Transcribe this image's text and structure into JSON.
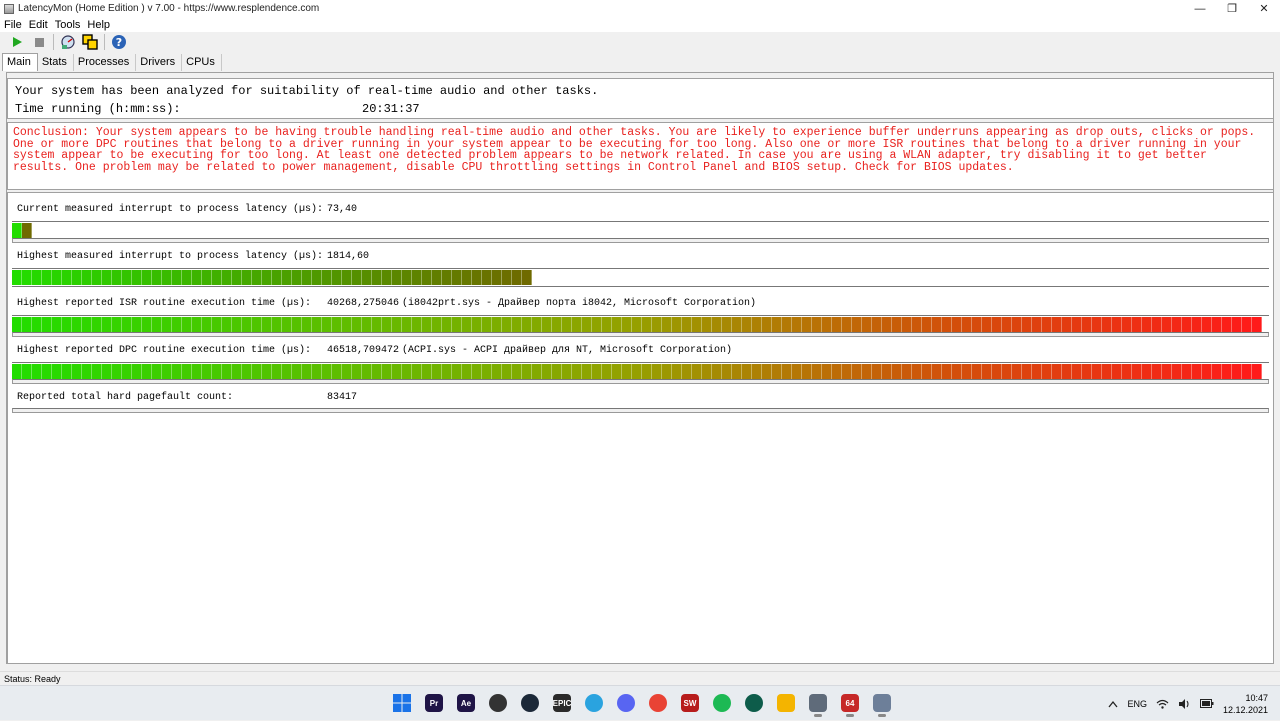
{
  "window": {
    "title": "LatencyMon  (Home Edition )  v 7.00 - https://www.resplendence.com",
    "minimize": "—",
    "maximize": "❐",
    "close": "✕"
  },
  "menu": [
    {
      "label": "File"
    },
    {
      "label": "Edit"
    },
    {
      "label": "Tools"
    },
    {
      "label": "Help"
    }
  ],
  "tabs": [
    {
      "label": "Main"
    },
    {
      "label": "Stats"
    },
    {
      "label": "Processes"
    },
    {
      "label": "Drivers"
    },
    {
      "label": "CPUs"
    }
  ],
  "summary": {
    "analyzed": "Your system has been analyzed for suitability of real-time audio and other tasks.",
    "time_label": "Time running (h:mm:ss):",
    "time_value": "20:31:37"
  },
  "conclusion": "Conclusion: Your system appears to be having trouble handling real-time audio and other tasks. You are likely to experience buffer underruns appearing as drop outs, clicks or pops. One or more DPC routines that belong to a driver running in your system appear to be executing for too long. Also one or more ISR routines that belong to a driver running in your system appear to be executing for too long. At least one detected problem appears to be network related. In case you are using a WLAN adapter, try disabling it to get better results. One problem may be related to power management, disable CPU throttling settings in Control Panel and BIOS setup. Check for BIOS updates.",
  "metrics": {
    "current": {
      "label": "Current measured interrupt to process latency (µs):",
      "value": "73,40",
      "fill": 0.017
    },
    "highest": {
      "label": "Highest measured interrupt to process latency (µs):",
      "value": "1814,60",
      "fill": 0.415
    },
    "isr": {
      "label": "Highest reported ISR routine execution time (µs):",
      "value": "40268,275046",
      "extra": "(i8042prt.sys - Драйвер порта i8042, Microsoft Corporation)",
      "fill": 1.0
    },
    "dpc": {
      "label": "Highest reported DPC routine execution time (µs):",
      "value": "46518,709472",
      "extra": "(ACPI.sys - ACPI драйвер для NT, Microsoft Corporation)",
      "fill": 1.0
    },
    "pagefault": {
      "label": "Reported total hard pagefault count:",
      "value": "83417"
    }
  },
  "status": "Status: Ready",
  "taskbar": {
    "apps": [
      {
        "icon": "windows-start-icon",
        "text": "",
        "color": "#1a73e8"
      },
      {
        "icon": "premiere-icon",
        "text": "Pr",
        "color": "#1f1446"
      },
      {
        "icon": "after-effects-icon",
        "text": "Ae",
        "color": "#1f1446"
      },
      {
        "icon": "obs-icon",
        "text": "",
        "color": "#333"
      },
      {
        "icon": "steam-icon",
        "text": "",
        "color": "#1b2838"
      },
      {
        "icon": "epic-games-icon",
        "text": "EPIC",
        "color": "#2a2a2a"
      },
      {
        "icon": "telegram-icon",
        "text": "",
        "color": "#2aa3df"
      },
      {
        "icon": "discord-icon",
        "text": "",
        "color": "#5865f2"
      },
      {
        "icon": "chrome-icon",
        "text": "",
        "color": "#e94335"
      },
      {
        "icon": "shadow-warrior-icon",
        "text": "SW",
        "color": "#b71c1c"
      },
      {
        "icon": "spotify-icon",
        "text": "",
        "color": "#1db954"
      },
      {
        "icon": "vpn-icon",
        "text": "",
        "color": "#0d5c4a"
      },
      {
        "icon": "file-explorer-icon",
        "text": "",
        "color": "#f4b400"
      },
      {
        "icon": "settings-icon",
        "text": "",
        "color": "#5f6b7a"
      },
      {
        "icon": "aida64-icon",
        "text": "64",
        "color": "#c62828"
      },
      {
        "icon": "latencymon-icon",
        "text": "",
        "color": "#6d7f99"
      }
    ],
    "lang": "ENG",
    "time": "10:47",
    "date": "12.12.2021"
  },
  "colors": {
    "conclusion_text": "#e8211e",
    "bar_green": "#22dd00",
    "bar_olive": "#6f6a00",
    "bar_red": "#ff1a1a"
  }
}
